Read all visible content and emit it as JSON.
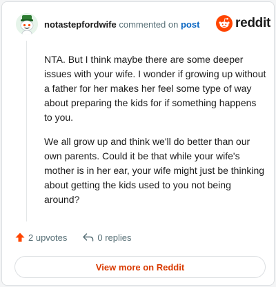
{
  "header": {
    "username": "notastepfordwife",
    "action_text": "commented on",
    "post_link": "post",
    "brand": "reddit"
  },
  "comment": {
    "paragraphs": [
      "NTA. But I think maybe there are some deeper issues with your wife. I wonder if growing up without a father for her makes her feel some type of way about preparing the kids for if something happens to you.",
      "We all grow up and think we'll do better than our own parents. Could it be that while your wife's mother is in her ear, your wife might just be thinking about getting the kids used to you not being around?"
    ]
  },
  "actions": {
    "upvotes": "2 upvotes",
    "replies": "0 replies"
  },
  "footer": {
    "view_more": "View more on Reddit"
  },
  "colors": {
    "brand_orange": "#ff4500",
    "link_blue": "#0a66c2",
    "view_more_text": "#d93a00"
  },
  "icons": {
    "avatar": "snoo-avatar-icon",
    "brand": "reddit-logo-icon",
    "upvote": "upvote-arrow-icon",
    "reply": "reply-arrow-icon"
  }
}
